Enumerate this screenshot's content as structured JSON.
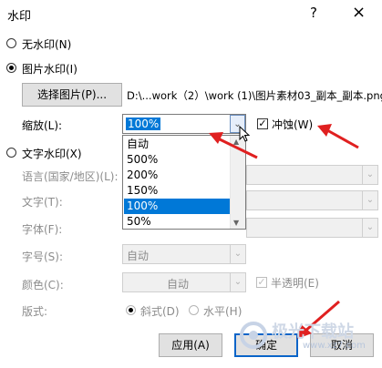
{
  "dialog": {
    "title": "水印",
    "help": "?",
    "close": "×"
  },
  "no_watermark": {
    "label": "无水印(N)",
    "selected": false
  },
  "picture_watermark": {
    "label": "图片水印(I)",
    "selected": true,
    "select_button": "选择图片(P)...",
    "file_path": "D:\\...work（2）\\work (1)\\图片素材03_副本_副本.png",
    "scale_label": "缩放(L):",
    "scale_value": "100%",
    "scale_options": [
      "自动",
      "500%",
      "200%",
      "150%",
      "100%",
      "50%"
    ],
    "scale_selected_index": 4,
    "washout_label": "冲蚀(W)",
    "washout_checked": true
  },
  "text_watermark": {
    "label": "文字水印(X)",
    "selected": false,
    "language_label": "语言(国家/地区)(L):",
    "text_label": "文字(T):",
    "font_label": "字体(F):",
    "size_label": "字号(S):",
    "size_value": "自动",
    "color_label": "颜色(C):",
    "color_value": "自动",
    "semitransparent_label": "半透明(E)",
    "semitransparent_checked": true,
    "layout_label": "版式:",
    "layout_diagonal": "斜式(D)",
    "layout_horizontal": "水平(H)",
    "layout_selected": "diagonal"
  },
  "buttons": {
    "apply": "应用(A)",
    "ok": "确定",
    "cancel": "取消"
  },
  "watermark_logo": {
    "text": "极光下载站",
    "url": "www.xz7.com"
  },
  "colors": {
    "selection": "#0078d7",
    "annotation_arrow": "#e02020",
    "primary_border": "#0a64c8"
  }
}
